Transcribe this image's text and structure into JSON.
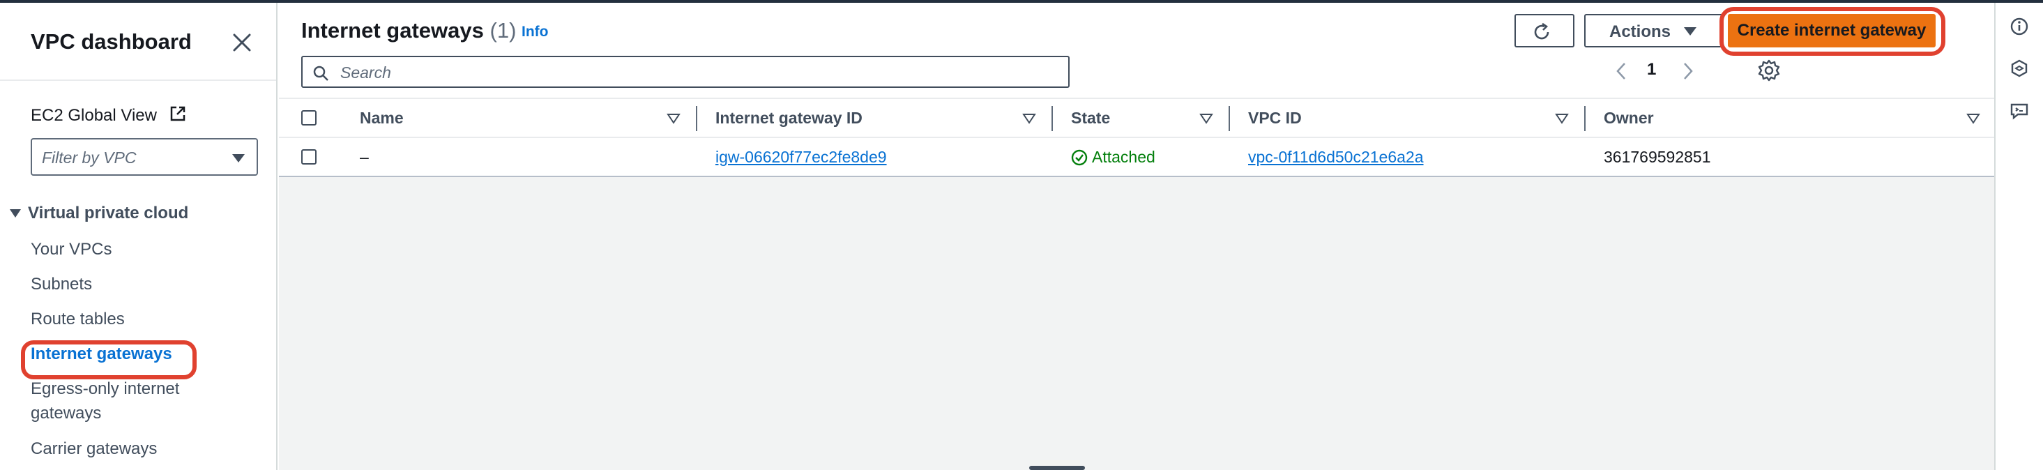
{
  "sidebar": {
    "title": "VPC dashboard",
    "ec2_global_view": "EC2 Global View",
    "filter_placeholder": "Filter by VPC",
    "section_title": "Virtual private cloud",
    "items": [
      {
        "label": "Your VPCs"
      },
      {
        "label": "Subnets"
      },
      {
        "label": "Route tables"
      },
      {
        "label": "Internet gateways",
        "active": true
      },
      {
        "label": "Egress-only internet gateways"
      },
      {
        "label": "Carrier gateways"
      }
    ]
  },
  "header": {
    "title": "Internet gateways",
    "count": "(1)",
    "info_label": "Info",
    "actions_label": "Actions",
    "create_label": "Create internet gateway",
    "search_placeholder": "Search",
    "current_page": "1"
  },
  "table": {
    "columns": [
      "Name",
      "Internet gateway ID",
      "State",
      "VPC ID",
      "Owner"
    ],
    "rows": [
      {
        "name": "–",
        "gateway_id": "igw-06620f77ec2fe8de9",
        "state": "Attached",
        "vpc_id": "vpc-0f11d6d50c21e6a2a",
        "owner": "361769592851"
      }
    ]
  },
  "colors": {
    "accent": "#0972d3",
    "primary_button": "#ec7211",
    "success": "#037f0c",
    "highlight": "#e0412f"
  },
  "icons": [
    "close-icon",
    "external-link-icon",
    "caret-down-icon",
    "refresh-icon",
    "search-icon",
    "chevron-left-icon",
    "chevron-right-icon",
    "settings-gear-icon",
    "info-icon",
    "hexagon-icon",
    "feedback-icon",
    "check-circle-icon",
    "sort-icon"
  ]
}
